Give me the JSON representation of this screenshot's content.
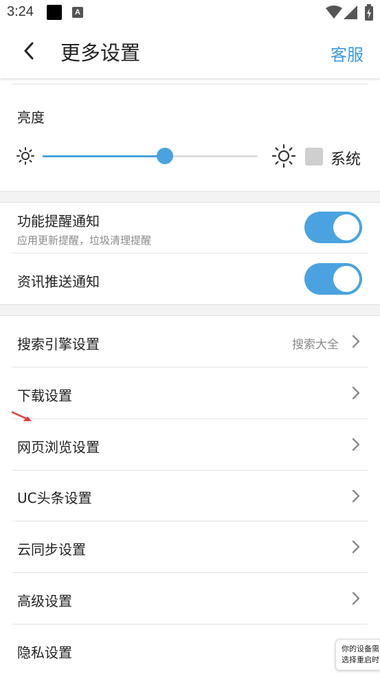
{
  "status_bar": {
    "time": "3:24",
    "notif_letter": "A"
  },
  "header": {
    "title": "更多设置",
    "service_label": "客服"
  },
  "brightness": {
    "title": "亮度",
    "level": 0.57,
    "system_label": "系统",
    "system_checked": false
  },
  "notifications": {
    "feature_title": "功能提醒通知",
    "feature_subtitle": "应用更新提醒，垃圾清理提醒",
    "feature_on": true,
    "news_title": "资讯推送通知",
    "news_on": true
  },
  "nav_items": [
    {
      "label": "搜索引擎设置",
      "value": "搜索大全"
    },
    {
      "label": "下载设置"
    },
    {
      "label": "网页浏览设置"
    },
    {
      "label": "UC头条设置"
    },
    {
      "label": "云同步设置"
    },
    {
      "label": "高级设置"
    },
    {
      "label": "隐私设置"
    }
  ],
  "toast": {
    "line1": "你的设备需",
    "line2": "选择重启时"
  },
  "colors": {
    "accent": "#4aa3e0",
    "link": "#3a9be0",
    "annotation_arrow": "#e53935"
  }
}
